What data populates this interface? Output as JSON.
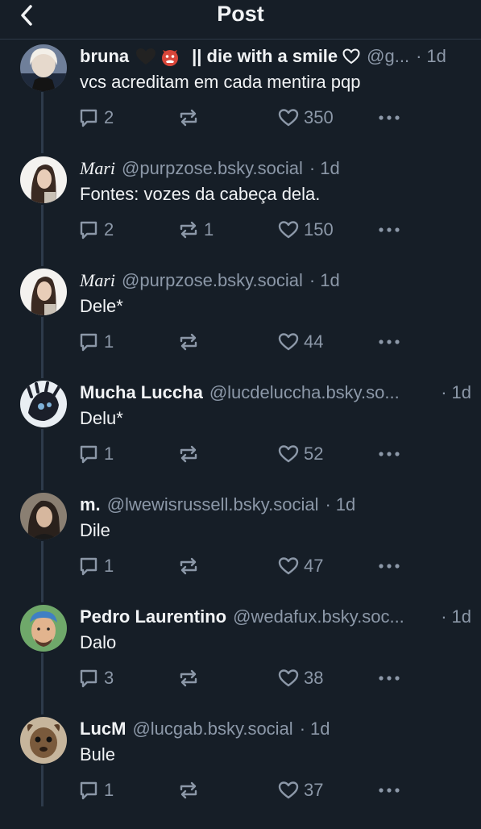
{
  "header": {
    "title": "Post",
    "back_icon": "chevron-left-icon"
  },
  "colors": {
    "background": "#161e27",
    "text": "#f1f3f5",
    "muted": "#8c98a8",
    "thread_line": "#2d3a4a"
  },
  "posts": [
    {
      "name": "bruna",
      "name_rest": "|| die with a smile",
      "name_emojis": [
        "black-heart-icon",
        "devil-face-icon",
        "white-heart-icon"
      ],
      "handle": "@g...",
      "time": "1d",
      "text": "vcs acreditam em cada mentira pqp",
      "replies": "2",
      "reposts": "",
      "likes": "350"
    },
    {
      "name": "Mari",
      "handle": "@purpzose.bsky.social",
      "time": "1d",
      "text": "Fontes: vozes da cabeça dela.",
      "replies": "2",
      "reposts": "1",
      "likes": "150"
    },
    {
      "name": "Mari",
      "handle": "@purpzose.bsky.social",
      "time": "1d",
      "text": "Dele*",
      "replies": "1",
      "reposts": "",
      "likes": "44"
    },
    {
      "name": "Mucha Luccha",
      "handle": "@lucdeluccha.bsky.so...",
      "time": "1d",
      "text": "Delu*",
      "replies": "1",
      "reposts": "",
      "likes": "52"
    },
    {
      "name": "m.",
      "handle": "@lwewisrussell.bsky.social",
      "time": "1d",
      "text": "Dile",
      "replies": "1",
      "reposts": "",
      "likes": "47"
    },
    {
      "name": "Pedro Laurentino",
      "handle": "@wedafux.bsky.soc...",
      "time": "1d",
      "text": "Dalo",
      "replies": "3",
      "reposts": "",
      "likes": "38"
    },
    {
      "name": "LucM",
      "handle": "@lucgab.bsky.social",
      "time": "1d",
      "text": "Bule",
      "replies": "1",
      "reposts": "",
      "likes": "37"
    }
  ],
  "separator": "·",
  "icons": {
    "reply": "reply-icon",
    "repost": "repost-icon",
    "like": "like-icon",
    "more": "more-options-icon"
  }
}
